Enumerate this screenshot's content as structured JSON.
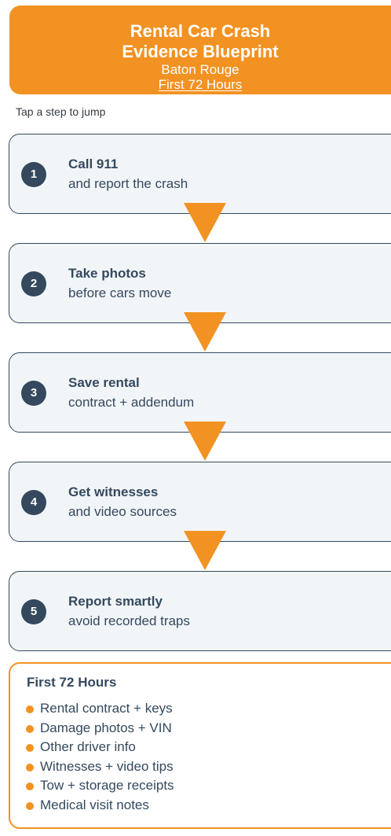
{
  "header": {
    "title_line1": "Rental Car Crash",
    "title_line2": "Evidence Blueprint",
    "subtitle_line1": "Baton Rouge",
    "subtitle_line2": "First 72 Hours"
  },
  "hint": "Tap a step to jump",
  "steps": [
    {
      "number": "1",
      "title": "Call 911",
      "desc": "and report the crash"
    },
    {
      "number": "2",
      "title": "Take photos",
      "desc": "before cars move"
    },
    {
      "number": "3",
      "title": "Save rental",
      "desc": "contract + addendum"
    },
    {
      "number": "4",
      "title": "Get witnesses",
      "desc": "and video sources"
    },
    {
      "number": "5",
      "title": "Report smartly",
      "desc": "avoid recorded traps"
    }
  ],
  "checklist": {
    "title": "First 72 Hours",
    "items": [
      "Rental contract + keys",
      "Damage photos + VIN",
      "Other driver info",
      "Witnesses + video tips",
      "Tow + storage receipts",
      "Medical visit notes"
    ]
  },
  "colors": {
    "accent": "#F29222",
    "primary": "#34495E",
    "card_bg": "#F2F5F8"
  }
}
